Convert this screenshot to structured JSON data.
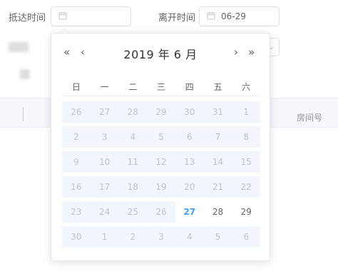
{
  "form": {
    "arrival_label": "抵达时间",
    "arrival_value": "",
    "departure_label": "离开时间",
    "departure_value": "06-29"
  },
  "table": {
    "column_room": "房间号"
  },
  "calendar": {
    "title": "2019 年  6 月",
    "prev_year": "«",
    "prev_month": "‹",
    "next_month": "›",
    "next_year": "»",
    "weekdays": [
      "日",
      "一",
      "二",
      "三",
      "四",
      "五",
      "六"
    ],
    "weeks": [
      [
        {
          "d": "26",
          "s": "out"
        },
        {
          "d": "27",
          "s": "out"
        },
        {
          "d": "28",
          "s": "out"
        },
        {
          "d": "29",
          "s": "out"
        },
        {
          "d": "30",
          "s": "out"
        },
        {
          "d": "31",
          "s": "out"
        },
        {
          "d": "1",
          "s": "out"
        }
      ],
      [
        {
          "d": "2",
          "s": "out"
        },
        {
          "d": "3",
          "s": "out"
        },
        {
          "d": "4",
          "s": "out"
        },
        {
          "d": "5",
          "s": "out"
        },
        {
          "d": "6",
          "s": "out"
        },
        {
          "d": "7",
          "s": "out"
        },
        {
          "d": "8",
          "s": "out"
        }
      ],
      [
        {
          "d": "9",
          "s": "out"
        },
        {
          "d": "10",
          "s": "out"
        },
        {
          "d": "11",
          "s": "out"
        },
        {
          "d": "12",
          "s": "out"
        },
        {
          "d": "13",
          "s": "out"
        },
        {
          "d": "14",
          "s": "out"
        },
        {
          "d": "15",
          "s": "out"
        }
      ],
      [
        {
          "d": "16",
          "s": "out"
        },
        {
          "d": "17",
          "s": "out"
        },
        {
          "d": "18",
          "s": "out"
        },
        {
          "d": "19",
          "s": "out"
        },
        {
          "d": "20",
          "s": "out"
        },
        {
          "d": "21",
          "s": "out"
        },
        {
          "d": "22",
          "s": "out"
        }
      ],
      [
        {
          "d": "23",
          "s": "out"
        },
        {
          "d": "24",
          "s": "out"
        },
        {
          "d": "25",
          "s": "out"
        },
        {
          "d": "26",
          "s": "out"
        },
        {
          "d": "27",
          "s": "today"
        },
        {
          "d": "28",
          "s": "current"
        },
        {
          "d": "29",
          "s": "current"
        }
      ],
      [
        {
          "d": "30",
          "s": "out"
        },
        {
          "d": "1",
          "s": "out"
        },
        {
          "d": "2",
          "s": "out"
        },
        {
          "d": "3",
          "s": "out"
        },
        {
          "d": "4",
          "s": "out"
        },
        {
          "d": "5",
          "s": "out"
        },
        {
          "d": "6",
          "s": "out"
        }
      ]
    ]
  },
  "colors": {
    "today": "#409eff",
    "disabled_bg": "#f2f6fc",
    "disabled_text": "#c0c4cc"
  }
}
